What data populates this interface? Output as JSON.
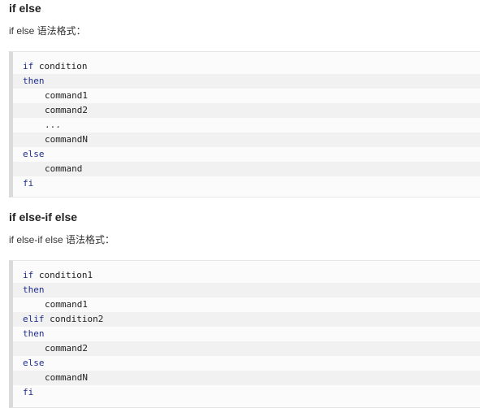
{
  "sections": [
    {
      "title": "if else",
      "description": "if else 语法格式：",
      "code": [
        {
          "kw": "if",
          "rest": " condition",
          "indent": false
        },
        {
          "kw": "then",
          "rest": "",
          "indent": false
        },
        {
          "kw": "",
          "rest": "command1",
          "indent": true
        },
        {
          "kw": "",
          "rest": "command2",
          "indent": true
        },
        {
          "kw": "",
          "rest": "...",
          "indent": true
        },
        {
          "kw": "",
          "rest": "commandN",
          "indent": true
        },
        {
          "kw": "else",
          "rest": "",
          "indent": false
        },
        {
          "kw": "",
          "rest": "command",
          "indent": true
        },
        {
          "kw": "fi",
          "rest": "",
          "indent": false
        }
      ]
    },
    {
      "title": "if else-if else",
      "description": "if else-if else 语法格式：",
      "code": [
        {
          "kw": "if",
          "rest": " condition1",
          "indent": false
        },
        {
          "kw": "then",
          "rest": "",
          "indent": false
        },
        {
          "kw": "",
          "rest": "command1",
          "indent": true
        },
        {
          "kw": "elif",
          "rest": " condition2",
          "indent": false
        },
        {
          "kw": "then",
          "rest": "",
          "indent": false
        },
        {
          "kw": "",
          "rest": "command2",
          "indent": true
        },
        {
          "kw": "else",
          "rest": "",
          "indent": false
        },
        {
          "kw": "",
          "rest": "commandN",
          "indent": true
        },
        {
          "kw": "fi",
          "rest": "",
          "indent": false
        }
      ]
    }
  ]
}
